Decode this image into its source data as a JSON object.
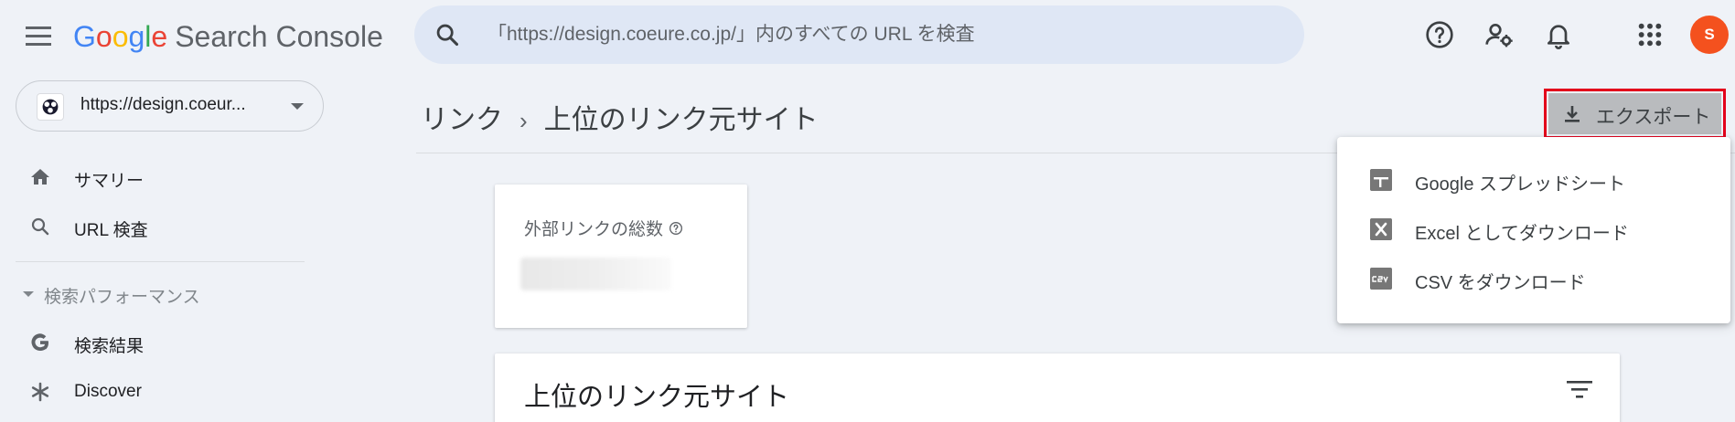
{
  "app": {
    "logo_letters": [
      "G",
      "o",
      "o",
      "g",
      "l",
      "e"
    ],
    "product": "Search Console"
  },
  "search": {
    "placeholder": "「https://design.coeure.co.jp/」内のすべての URL を検査"
  },
  "header_icons": [
    "help-icon",
    "manage-users-icon",
    "notifications-icon",
    "apps-grid-icon"
  ],
  "user": {
    "avatar_letter": "S",
    "avatar_color": "#f4511e"
  },
  "property": {
    "label": "https://design.coeur..."
  },
  "sidebar": {
    "items": [
      {
        "label": "サマリー",
        "icon": "home-icon"
      },
      {
        "label": "URL 検査",
        "icon": "search-icon"
      }
    ],
    "section": {
      "label": "検索パフォーマンス"
    },
    "section_items": [
      {
        "label": "検索結果",
        "icon": "google-g-icon"
      },
      {
        "label": "Discover",
        "icon": "asterisk-icon"
      }
    ]
  },
  "breadcrumb": {
    "parent": "リンク",
    "separator": "›",
    "current": "上位のリンク元サイト"
  },
  "export_button": {
    "label": "エクスポート",
    "highlight_color": "#e3001b"
  },
  "export_menu": {
    "items": [
      {
        "label": "Google スプレッドシート",
        "icon": "sheets-icon"
      },
      {
        "label": "Excel としてダウンロード",
        "icon": "excel-icon"
      },
      {
        "label": "CSV をダウンロード",
        "icon": "csv-icon"
      }
    ]
  },
  "stats_card": {
    "title": "外部リンクの総数"
  },
  "table_card": {
    "title": "上位のリンク元サイト"
  },
  "colors": {
    "background": "#eff2f7",
    "search_bg": "#dfe7f5",
    "google_blue": "#4285f4",
    "google_red": "#ea4335",
    "google_yellow": "#fbbc05",
    "google_green": "#34a853"
  }
}
